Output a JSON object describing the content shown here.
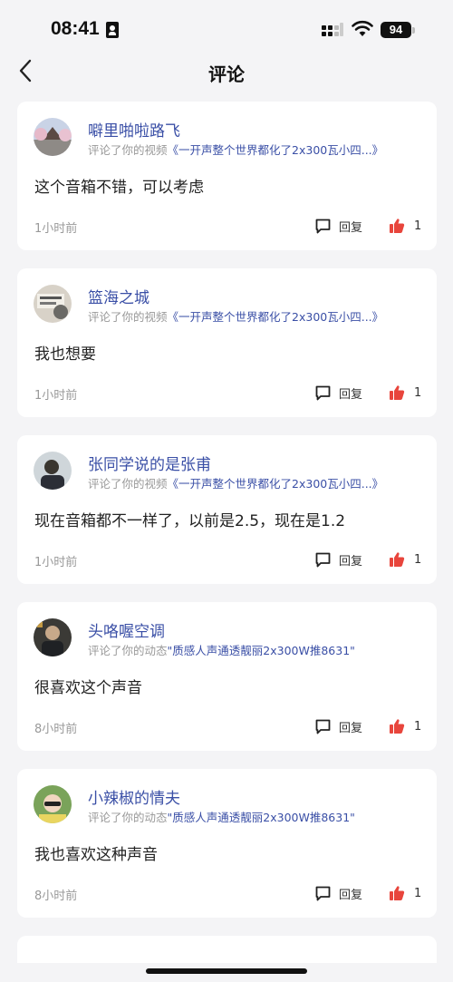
{
  "status_bar": {
    "time": "08:41",
    "battery": "94"
  },
  "nav": {
    "title": "评论"
  },
  "comments": [
    {
      "username": "噼里啪啦路飞",
      "prefix": "评论了你的视频",
      "target": "《一开声整个世界都化了2x300瓦小四...》",
      "text": "这个音箱不错，可以考虑",
      "time": "1小时前",
      "reply_label": "回复",
      "likes": "1"
    },
    {
      "username": "篮海之城",
      "prefix": "评论了你的视频",
      "target": "《一开声整个世界都化了2x300瓦小四...》",
      "text": "我也想要",
      "time": "1小时前",
      "reply_label": "回复",
      "likes": "1"
    },
    {
      "username": "张同学说的是张甫",
      "prefix": "评论了你的视频",
      "target": "《一开声整个世界都化了2x300瓦小四...》",
      "text": "现在音箱都不一样了，以前是2.5，现在是1.2",
      "time": "1小时前",
      "reply_label": "回复",
      "likes": "1"
    },
    {
      "username": "头咯喔空调",
      "prefix": "评论了你的动态",
      "target": "\"质感人声通透靓丽2x300W推8631\"",
      "text": "很喜欢这个声音",
      "time": "8小时前",
      "reply_label": "回复",
      "likes": "1"
    },
    {
      "username": "小辣椒的情夫",
      "prefix": "评论了你的动态",
      "target": "\"质感人声通透靓丽2x300W推8631\"",
      "text": "我也喜欢这种声音",
      "time": "8小时前",
      "reply_label": "回复",
      "likes": "1"
    }
  ],
  "colors": {
    "accent": "#3a4fa6",
    "like": "#e8453c",
    "background": "#f4f4f6"
  },
  "icons": [
    "back-icon",
    "reply-icon",
    "thumbs-up-icon",
    "signal-icon",
    "wifi-icon",
    "battery-icon"
  ]
}
